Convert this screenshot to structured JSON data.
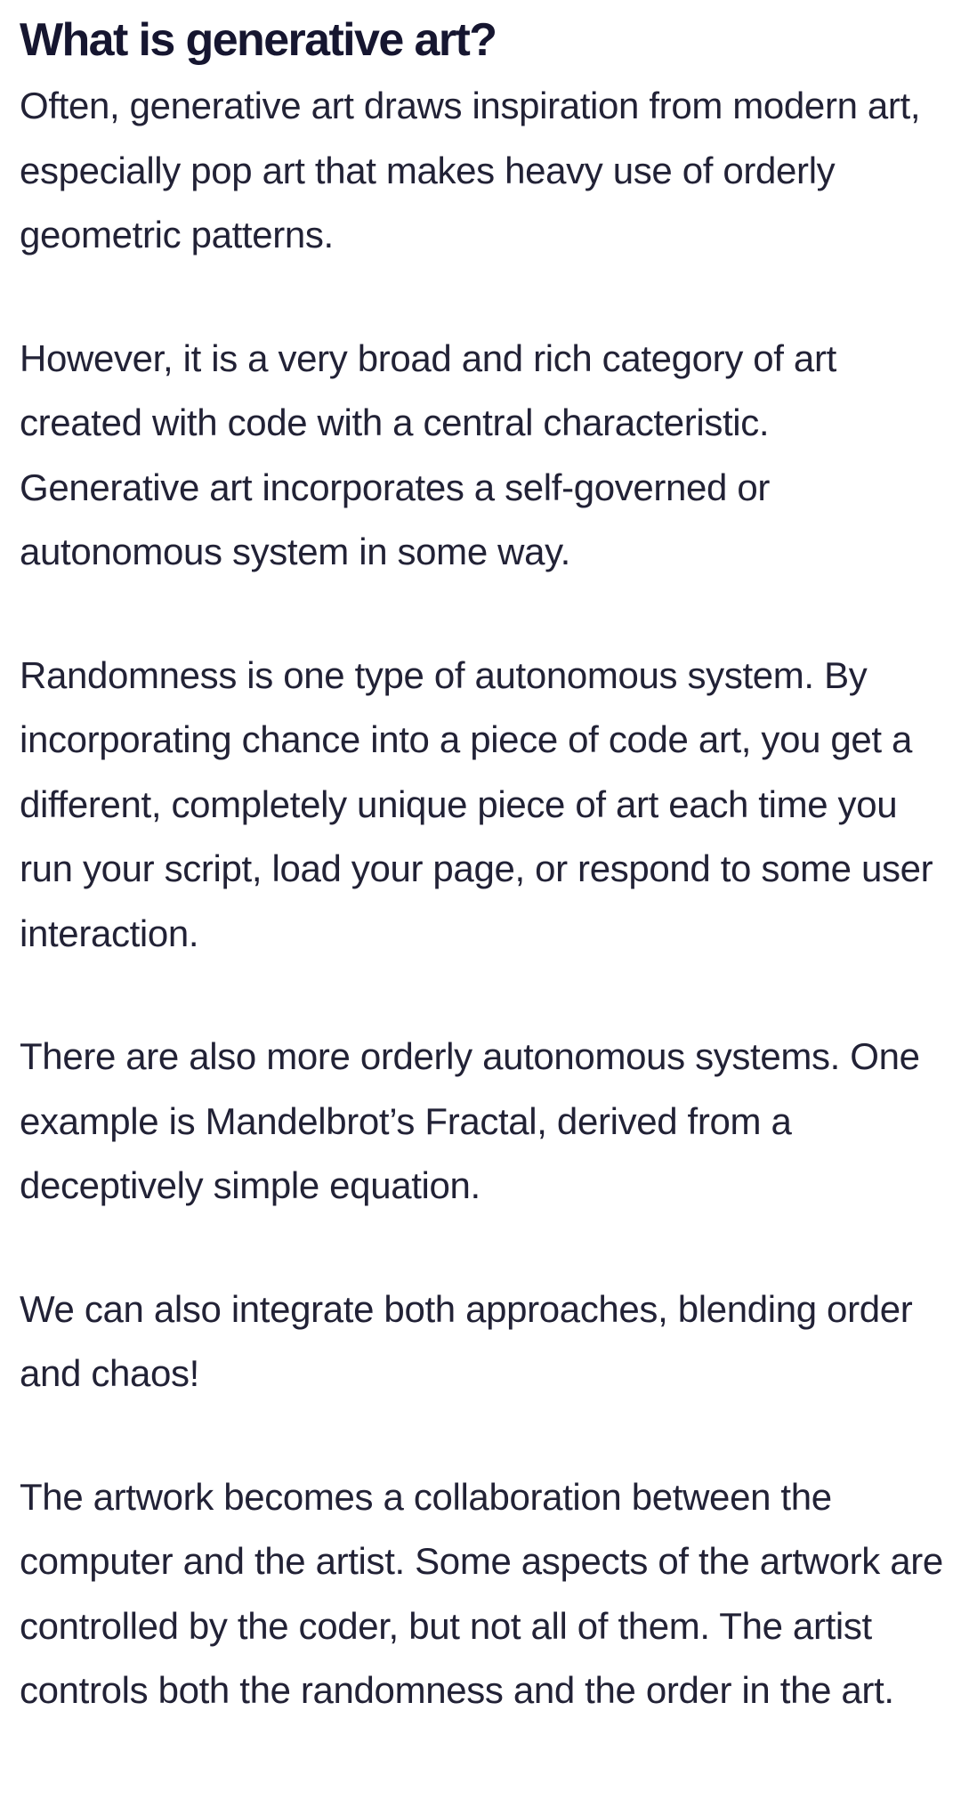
{
  "article": {
    "title": "What is generative art?",
    "paragraphs": [
      "Often, generative art draws inspiration from modern art, especially pop art that makes heavy use of orderly geometric patterns.",
      "However, it is a very broad and rich category of art created with code with a central characteristic. Generative art incorporates a self-governed or autonomous system in some way.",
      "Randomness is one type of autonomous system. By incorporating chance into a piece of code art, you get a different, completely unique piece of art each time you run your script, load your page, or respond to some user interaction.",
      "There are also more orderly autonomous systems. One example is Mandelbrot’s Fractal, derived from a deceptively simple equation.",
      "We can also integrate both approaches, blending order and chaos!",
      "The artwork becomes a collaboration between the computer and the artist. Some aspects of the artwork are controlled by the coder, but not all of them. The artist controls both the randomness and the order in the art."
    ]
  },
  "colors": {
    "background": "#ffffff",
    "heading": "#161630",
    "body_text": "#222236"
  }
}
